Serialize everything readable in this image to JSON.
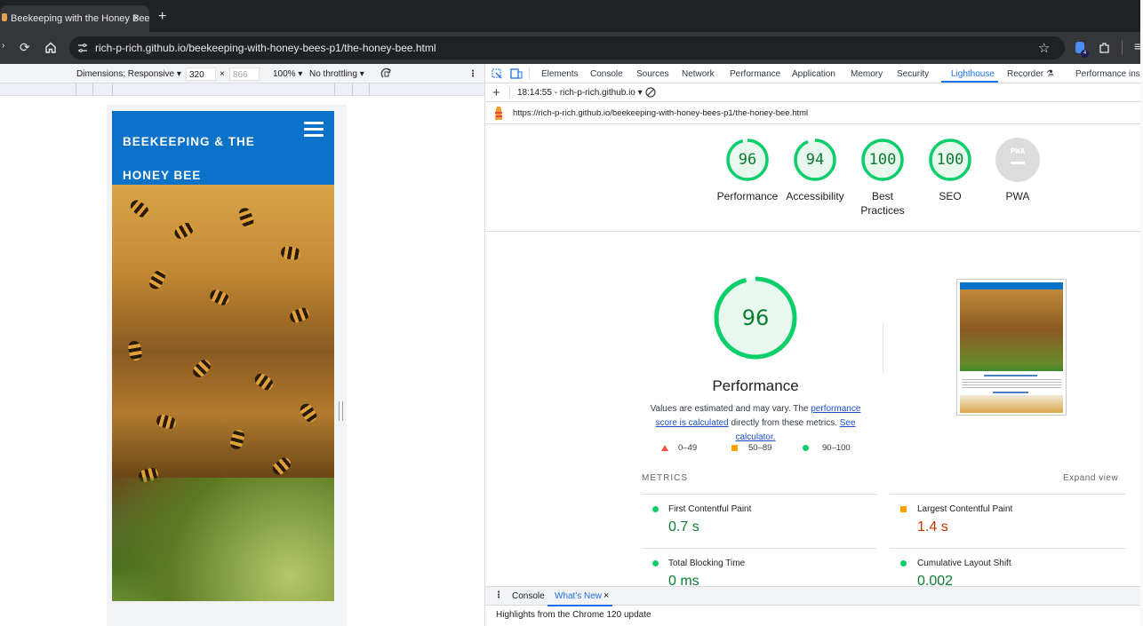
{
  "browser": {
    "tab_title": "Beekeeping with the Honey Bee",
    "tab_close": "×",
    "new_tab": "+",
    "url": "rich-p-rich.github.io/beekeeping-with-honey-bees-p1/the-honey-bee.html",
    "extension_badge": "4"
  },
  "emulation": {
    "dimensions_label": "Dimensions: Responsive ▾",
    "width": "320",
    "times": "×",
    "height_placeholder": "866",
    "zoom": "100% ▾",
    "throttling": "No throttling ▾"
  },
  "site": {
    "title_line1": "BEEKEEPING & THE",
    "title_line2": "HONEY BEE",
    "header_color": "#0a72c8"
  },
  "devtools": {
    "tabs": [
      "Elements",
      "Console",
      "Sources",
      "Network",
      "Performance",
      "Application",
      "Memory",
      "Security",
      "Lighthouse",
      "Recorder ⚗",
      "Performance insig"
    ],
    "report_select": "18:14:55 - rich-p-rich.github.io ▾",
    "report_url": "https://rich-p-rich.github.io/beekeeping-with-honey-bees-p1/the-honey-bee.html"
  },
  "lighthouse": {
    "scores": [
      {
        "value": "96",
        "label": "Performance",
        "level": 0.96
      },
      {
        "value": "94",
        "label": "Accessibility",
        "level": 0.94
      },
      {
        "value": "100",
        "label": "Best Practices",
        "level": 1.0
      },
      {
        "value": "100",
        "label": "SEO",
        "level": 1.0
      },
      {
        "value": "PWA",
        "label": "PWA",
        "level": 0
      }
    ],
    "main_score": "96",
    "main_level": 0.96,
    "main_title": "Performance",
    "desc_prefix": "Values are estimated and may vary. The ",
    "desc_link1": "performance score is calculated",
    "desc_middle": " directly from these metrics. ",
    "desc_link2": "See calculator.",
    "legend": [
      "0–49",
      "50–89",
      "90–100"
    ],
    "metrics_heading": "METRICS",
    "expand_view": "Expand view",
    "metrics": [
      {
        "label": "First Contentful Paint",
        "value": "0.7 s",
        "status": "pass"
      },
      {
        "label": "Largest Contentful Paint",
        "value": "1.4 s",
        "status": "average"
      },
      {
        "label": "Total Blocking Time",
        "value": "0 ms",
        "status": "pass"
      },
      {
        "label": "Cumulative Layout Shift",
        "value": "0.002",
        "status": "pass"
      }
    ],
    "colors": {
      "pass": "#0cce6b",
      "pass_text": "#0c7c30",
      "average": "#ffa400",
      "average_text": "#c33300",
      "fail": "#ff4e42"
    }
  },
  "drawer": {
    "tabs": [
      "Console",
      "What's New"
    ],
    "close": "×",
    "highlights": "Highlights from the Chrome 120 update"
  }
}
